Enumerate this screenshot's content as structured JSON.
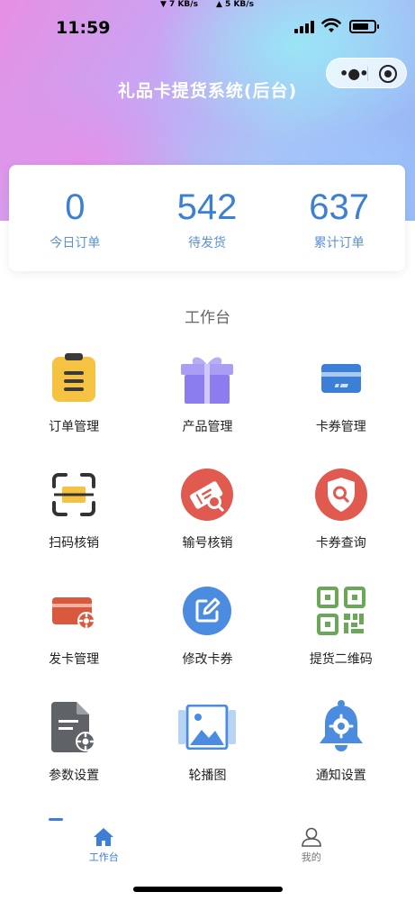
{
  "status_bar": {
    "time": "11:59",
    "download_speed": "▼ 7 KB/s",
    "upload_speed": "▲ 5 KB/s"
  },
  "header": {
    "title": "礼品卡提货系统(后台)"
  },
  "stats": [
    {
      "value": "0",
      "label": "今日订单"
    },
    {
      "value": "542",
      "label": "待发货"
    },
    {
      "value": "637",
      "label": "累计订单"
    }
  ],
  "workbench": {
    "title": "工作台",
    "items": [
      {
        "label": "订单管理",
        "icon": "order-clipboard-icon"
      },
      {
        "label": "产品管理",
        "icon": "gift-box-icon"
      },
      {
        "label": "卡券管理",
        "icon": "card-icon"
      },
      {
        "label": "扫码核销",
        "icon": "scan-icon"
      },
      {
        "label": "输号核销",
        "icon": "ticket-search-icon"
      },
      {
        "label": "卡券查询",
        "icon": "shield-search-icon"
      },
      {
        "label": "发卡管理",
        "icon": "card-gear-icon"
      },
      {
        "label": "修改卡券",
        "icon": "edit-icon"
      },
      {
        "label": "提货二维码",
        "icon": "qr-code-icon"
      },
      {
        "label": "参数设置",
        "icon": "document-gear-icon"
      },
      {
        "label": "轮播图",
        "icon": "image-gallery-icon"
      },
      {
        "label": "通知设置",
        "icon": "bell-gear-icon"
      }
    ]
  },
  "tabbar": {
    "items": [
      {
        "label": "工作台",
        "icon": "home-icon",
        "active": true
      },
      {
        "label": "我的",
        "icon": "user-icon",
        "active": false
      }
    ]
  },
  "colors": {
    "accent": "#3b7fd6",
    "yellow": "#f5c242",
    "purple": "#8b7cf0",
    "red": "#e05a4f",
    "orange_red": "#d9593f",
    "green": "#6aa857",
    "gray": "#5f6368"
  }
}
